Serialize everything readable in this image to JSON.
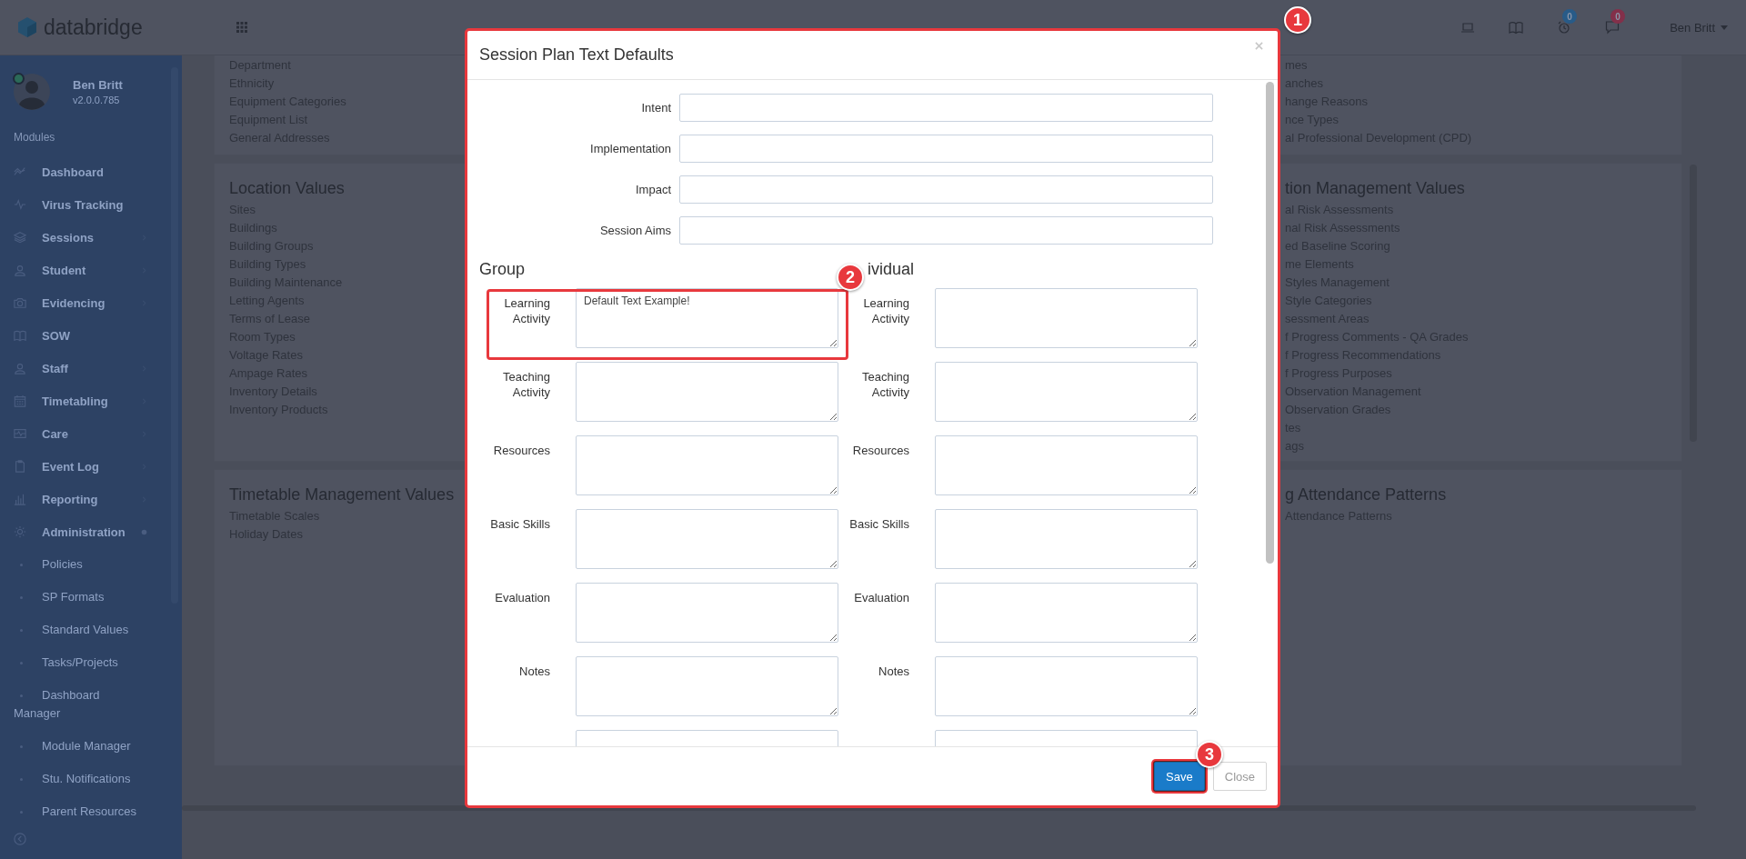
{
  "header": {
    "brand": "databridge",
    "user": "Ben Britt",
    "badges": [
      {
        "count": "0",
        "color": "#285b88"
      },
      {
        "count": "0",
        "color": "#83304a"
      }
    ]
  },
  "sidebar": {
    "user": {
      "name": "Ben Britt",
      "version": "v2.0.0.785",
      "online": true
    },
    "section": "Modules",
    "items": [
      {
        "label": "Dashboard"
      },
      {
        "label": "Virus Tracking"
      },
      {
        "label": "Sessions",
        "expanded": false
      },
      {
        "label": "Student",
        "expanded": false
      },
      {
        "label": "Evidencing",
        "expanded": false
      },
      {
        "label": "SOW"
      },
      {
        "label": "Staff",
        "expanded": false
      },
      {
        "label": "Timetabling",
        "expanded": false
      },
      {
        "label": "Care",
        "expanded": false
      },
      {
        "label": "Event Log",
        "expanded": false
      },
      {
        "label": "Reporting",
        "expanded": false
      },
      {
        "label": "Administration",
        "expanded": true,
        "children": [
          {
            "label": "Policies"
          },
          {
            "label": "SP Formats"
          },
          {
            "label": "Standard Values"
          },
          {
            "label": "Tasks/Projects"
          },
          {
            "label": "Dashboard Manager"
          },
          {
            "label": "Module Manager"
          },
          {
            "label": "Stu. Notifications"
          },
          {
            "label": "Parent Resources"
          }
        ]
      }
    ]
  },
  "cards": [
    {
      "left": {
        "items": [
          "Department",
          "Ethnicity",
          "Equipment Categories",
          "Equipment List",
          "General Addresses"
        ]
      },
      "right": {
        "items": [
          "mes",
          "anches",
          "hange Reasons",
          "nce Types",
          "al Professional Development (CPD)"
        ]
      }
    },
    {
      "left": {
        "heading": "Location Values",
        "items": [
          "Sites",
          "Buildings",
          "Building Groups",
          "Building Types",
          "Building Maintenance",
          "Letting Agents",
          "Terms of Lease",
          "Room Types",
          "Voltage Rates",
          "Ampage Rates",
          "Inventory Details",
          "Inventory Products"
        ]
      },
      "right": {
        "heading": "tion Management Values",
        "items": [
          "al Risk Assessments",
          "nal Risk Assessments",
          "ed Baseline Scoring",
          "me Elements",
          "Styles Management",
          "Style Categories",
          "sessment Areas",
          "f Progress Comments - QA Grades",
          "f Progress Recommendations",
          "f Progress Purposes",
          "Observation Management",
          "Observation Grades",
          "tes",
          "ags"
        ]
      }
    },
    {
      "left": {
        "heading": "Timetable Management Values",
        "items": [
          "Timetable Scales",
          "Holiday Dates"
        ]
      },
      "right": {
        "heading": "g Attendance Patterns",
        "items": [
          "Attendance Patterns"
        ]
      }
    }
  ],
  "modal": {
    "title": "Session Plan Text Defaults",
    "fields": [
      {
        "label": "Intent"
      },
      {
        "label": "Implementation"
      },
      {
        "label": "Impact"
      },
      {
        "label": "Session Aims"
      }
    ],
    "columns": [
      {
        "heading": "Group",
        "rows": [
          {
            "kind": "textarea",
            "label": "Learning Activity",
            "value": "Default Text Example!"
          },
          {
            "kind": "textarea",
            "label": "Teaching Activity"
          },
          {
            "kind": "textarea",
            "label": "Resources"
          },
          {
            "kind": "textarea",
            "label": "Basic Skills"
          },
          {
            "kind": "textarea",
            "label": "Evaluation"
          },
          {
            "kind": "textarea",
            "label": "Notes"
          },
          {
            "kind": "textarea"
          }
        ]
      },
      {
        "heading": "ividual",
        "rows": [
          {
            "kind": "textarea",
            "label": "Learning Activity"
          },
          {
            "kind": "textarea",
            "label": "Teaching Activity"
          },
          {
            "kind": "textarea",
            "label": "Resources"
          },
          {
            "kind": "textarea",
            "label": "Basic Skills"
          },
          {
            "kind": "textarea",
            "label": "Evaluation"
          },
          {
            "kind": "textarea",
            "label": "Notes"
          },
          {
            "kind": "textarea"
          }
        ]
      }
    ],
    "buttons": [
      {
        "label": "Save",
        "kind": "primary"
      },
      {
        "label": "Close",
        "kind": "default"
      }
    ]
  },
  "annotations": [
    {
      "number": "1"
    },
    {
      "number": "2"
    },
    {
      "number": "3"
    }
  ]
}
